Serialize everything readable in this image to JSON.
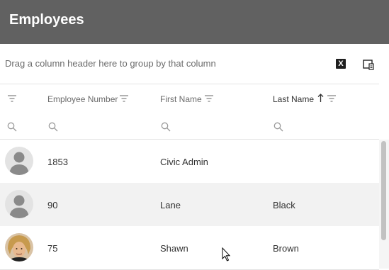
{
  "header": {
    "title": "Employees"
  },
  "groupbar": {
    "hint": "Drag a column header here to group by that column"
  },
  "toolbar": {
    "excel_label": "X"
  },
  "columns": [
    {
      "label": "Employee Number"
    },
    {
      "label": "First Name"
    },
    {
      "label": "Last Name"
    }
  ],
  "rows": [
    {
      "number": "1853",
      "first": "Civic Admin",
      "last": ""
    },
    {
      "number": "90",
      "first": "Lane",
      "last": "Black"
    },
    {
      "number": "75",
      "first": "Shawn",
      "last": "Brown"
    }
  ],
  "colors": {
    "header_bg": "#616161",
    "row_alt_bg": "#f2f2f2",
    "text": "#333333"
  },
  "icons": [
    "filter-icon",
    "sort-ascending-icon",
    "search-icon",
    "excel-export-icon",
    "column-chooser-icon",
    "avatar-placeholder-icon",
    "mouse-cursor-icon"
  ]
}
